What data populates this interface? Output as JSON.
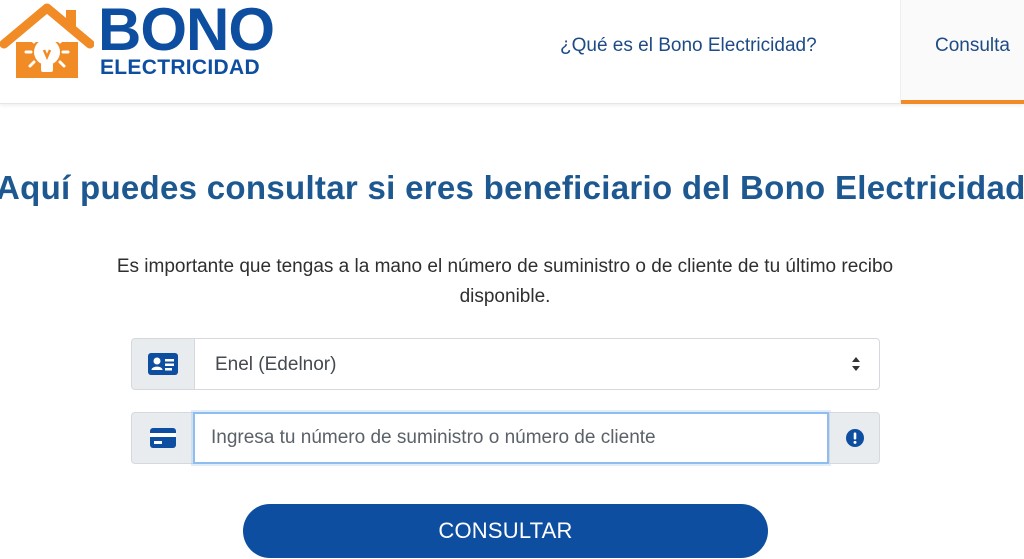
{
  "header": {
    "logo": {
      "title": "BONO",
      "subtitle": "ELECTRICIDAD",
      "icon": "house-bulb-icon"
    },
    "nav": [
      {
        "label": "¿Qué es el Bono Electricidad?"
      },
      {
        "label": "Consulta",
        "active": true
      }
    ]
  },
  "main": {
    "title": "Aquí puedes consultar si eres beneficiario del Bono Electricidad",
    "description": "Es importante que tengas a la mano el número de suministro o de cliente de tu último recibo disponible.",
    "provider_select": {
      "icon": "id-card-icon",
      "value": "Enel (Edelnor)"
    },
    "number_input": {
      "icon": "credit-card-icon",
      "placeholder": "Ingresa tu número de suministro o número de cliente",
      "value": "",
      "help_icon": "info-circle-icon"
    },
    "submit_label": "CONSULTAR"
  },
  "colors": {
    "brand_blue": "#0e4ea1",
    "accent_orange": "#f08b26",
    "title_blue": "#1e5891"
  }
}
